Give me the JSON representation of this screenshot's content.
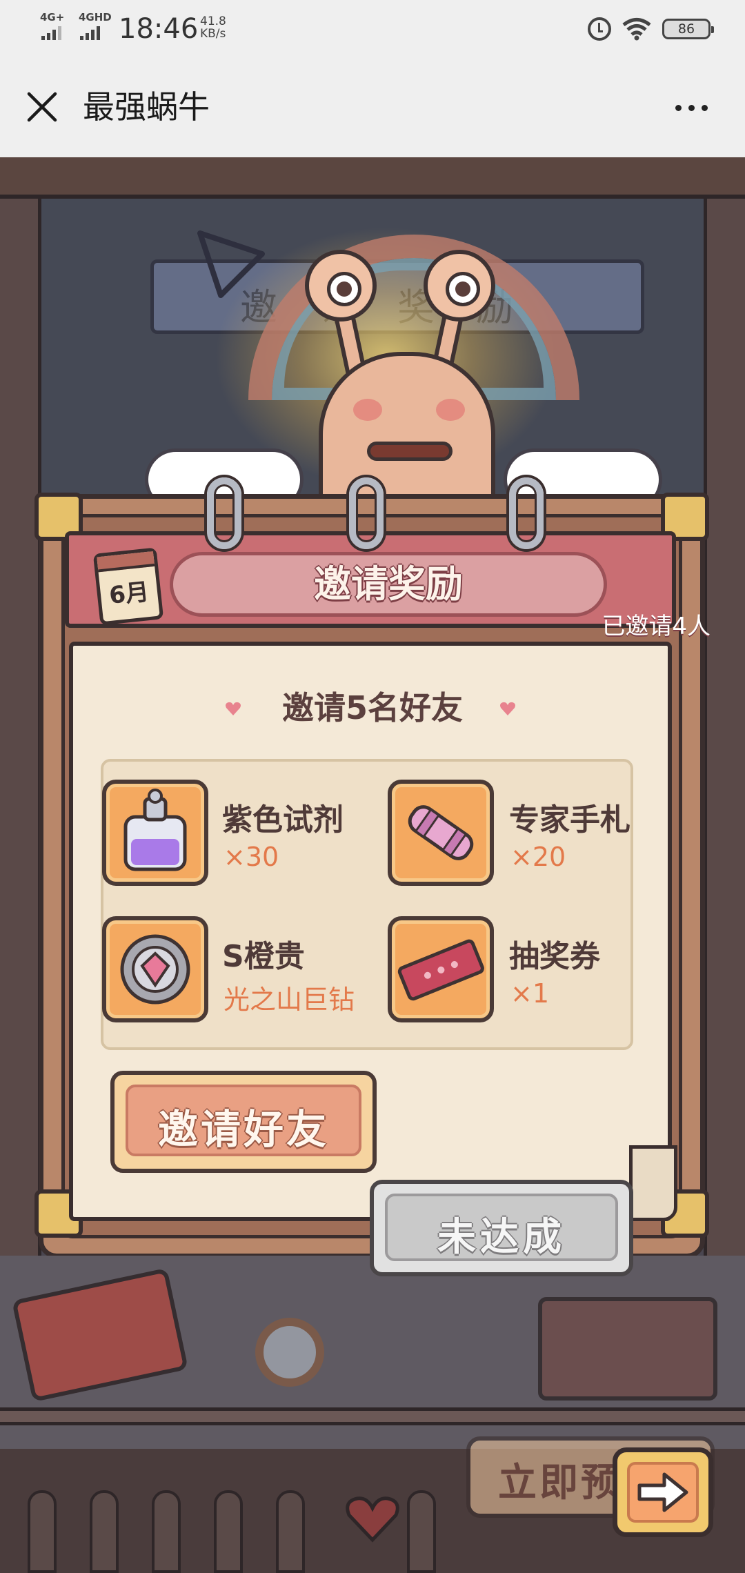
{
  "status_bar": {
    "net1": "4G+",
    "net2": "4GHD",
    "time": "18:46",
    "speed_value": "41.8",
    "speed_unit": "KB/s",
    "battery": "86"
  },
  "titlebar": {
    "title": "最强蜗牛"
  },
  "scene": {
    "sign_text": "邀请奖励"
  },
  "card": {
    "calendar": "6月",
    "title": "邀请奖励",
    "invited": "已邀请4人",
    "subtitle": "邀请5名好友",
    "rewards": [
      {
        "name": "紫色试剂",
        "count": "×30",
        "icon": "purple-potion-icon"
      },
      {
        "name": "专家手札",
        "count": "×20",
        "icon": "expert-scroll-icon"
      },
      {
        "name": "S橙贵",
        "count": "光之山巨钻",
        "icon": "diamond-badge-icon"
      },
      {
        "name": "抽奖券",
        "count": "×1",
        "icon": "lottery-ticket-icon"
      }
    ],
    "invite_button": "邀请好友",
    "status_button": "未达成"
  },
  "footer": {
    "preorder_label": "立即预"
  },
  "colors": {
    "accent_orange": "#e3794a",
    "header_pink": "#c96e73",
    "tile_orange": "#f4a960",
    "paper": "#f4e9d7"
  }
}
